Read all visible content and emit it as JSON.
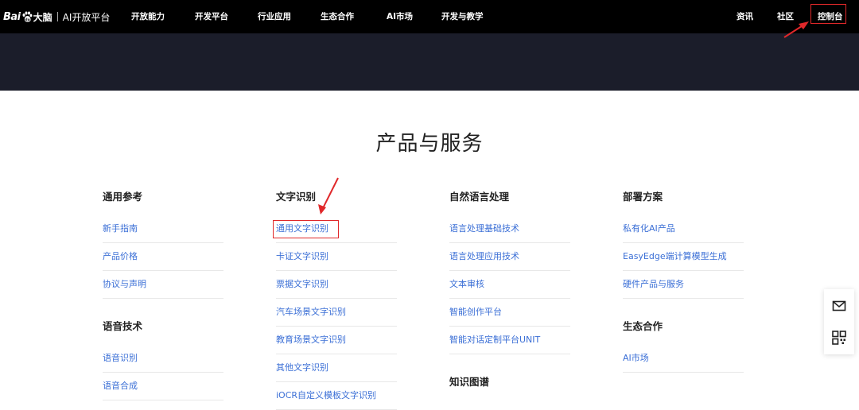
{
  "header": {
    "logo_brand": "Bai",
    "logo_cn": "大脑",
    "logo_sub": "AI开放平台",
    "nav_items": [
      "开放能力",
      "开发平台",
      "行业应用",
      "生态合作",
      "AI市场",
      "开发与教学"
    ],
    "right_items": [
      "资讯",
      "社区",
      "控制台"
    ]
  },
  "main": {
    "title": "产品与服务",
    "columns": [
      {
        "groups": [
          {
            "title": "通用参考",
            "links": [
              "新手指南",
              "产品价格",
              "协议与声明"
            ]
          },
          {
            "title": "语音技术",
            "links": [
              "语音识别",
              "语音合成"
            ]
          }
        ]
      },
      {
        "groups": [
          {
            "title": "文字识别",
            "links": [
              "通用文字识别",
              "卡证文字识别",
              "票据文字识别",
              "汽车场景文字识别",
              "教育场景文字识别",
              "其他文字识别",
              "iOCR自定义模板文字识别"
            ]
          }
        ]
      },
      {
        "groups": [
          {
            "title": "自然语言处理",
            "links": [
              "语言处理基础技术",
              "语言处理应用技术",
              "文本审核",
              "智能创作平台",
              "智能对话定制平台UNIT"
            ]
          },
          {
            "title": "知识图谱",
            "links": []
          }
        ]
      },
      {
        "groups": [
          {
            "title": "部署方案",
            "links": [
              "私有化AI产品",
              "EasyEdge端计算模型生成",
              "硬件产品与服务"
            ]
          },
          {
            "title": "生态合作",
            "links": [
              "AI市场"
            ]
          }
        ]
      }
    ]
  },
  "side_panel": {
    "icons": [
      "mail-icon",
      "qrcode-icon"
    ]
  },
  "colors": {
    "nav_bg": "#000000",
    "banner_bg": "#1b1d2a",
    "link": "#3b6fd6",
    "highlight": "#e0282a"
  }
}
